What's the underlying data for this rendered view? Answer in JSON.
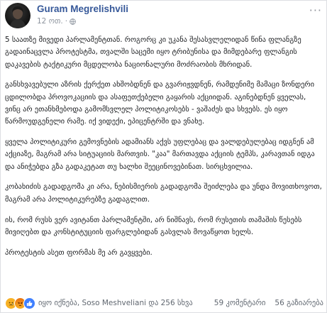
{
  "post": {
    "author": "Guram Megrelishvili",
    "timestamp": "12 ოთ.",
    "paragraphs": [
      "5 საათზე მივედი პარლამენტთან. როგორც კი უკანა შესასვლელიდან წინა ფლანგზე გადაინაცვლა პროტესტმა, თვალში საცემი იყო ტრიბუნისა და მიმდებარე ფლანგის დაკავების ტაქტიკური მცდელობა ნაციონალური მოძრაობის მხრიდან.",
      "განსხვავებული აზრის ქერქეთ ახშობდნენ და გვარიჟვდნენ, რამდენიმე მამაცი ზონდერი ცდილობდა პროვოკაციის და ასაფეთქებელი გაყარის აქციიდან. აგინებდნენ ყველას, ვინც არ ეთანხმებოდა გამომსვლელ პოლიტიკოსებს - ვაშაძეს და სხვებს. ეს იყო წარმოუდგენელი რამე. იქ ვიდექი, ეპიცენტრში და ვნახე.",
      "ყველა პოლიტიკური გემოვნების ადამიანს აქვს უფლებაც და ვალდებულებაც იდგნენ ამ აქციაზე, მაგრამ არა სიტუაციის მართვის. \"კაა\" მართავდა აქციის ტემპს, კარავთან იდგა და ანიჭებდა გზა გადაკეტათ თუ ხალხი შეეცინოვებინათ. სირცხვილია.",
      "კობახიძის გადადგომა კი არა, ნებისმიერის გადადგომა შეიძლება და უნდა მოვითხოვოთ, მაგრამ არა პოლიტიკურებზე გადაგლით.",
      "ის, რომ რუსს ვერ ავიტანთ პარლამენტში, არ ნიშნავს, რომ რუსეთის თამაშის წესებს მივიღებთ და კონსტიტუციის ფარგლებიდან გასვლას მოვაწყოთ ხელს.",
      "პროტესტის ასეთ ფორმას მე არ გავყვები."
    ]
  },
  "reactions": {
    "icons": [
      "sad-emoji",
      "angry-emoji",
      "like-thumb"
    ],
    "summary": "იყო იქნება, Soso Meshveliani და 256 სხვა"
  },
  "stats": {
    "comments": "59 კომენტარი",
    "shares": "56 გაზიარება"
  }
}
